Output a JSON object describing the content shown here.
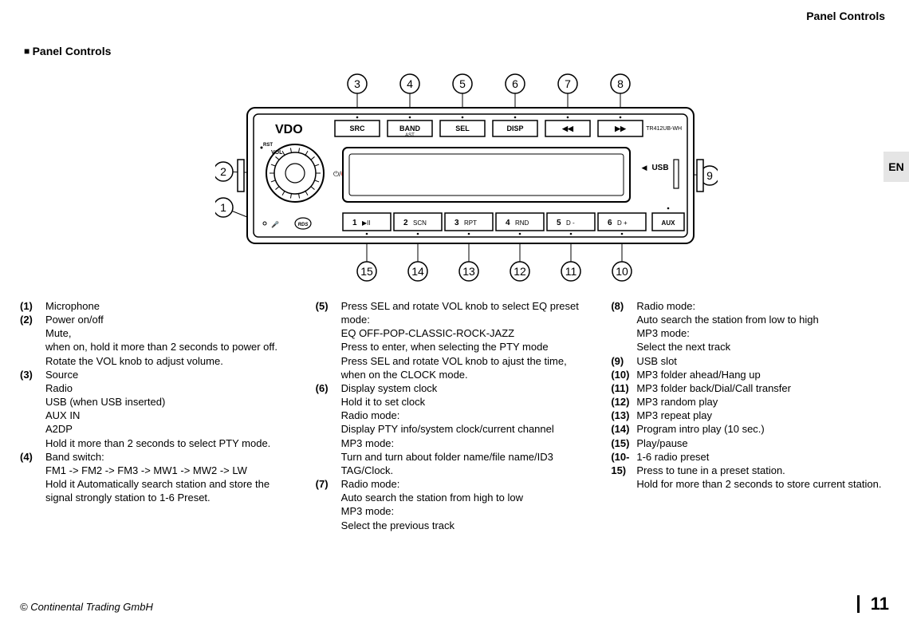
{
  "header": {
    "title": "Panel Controls"
  },
  "section_title": "Panel Controls",
  "lang_tab": "EN",
  "footer": {
    "copyright": "© Continental Trading GmbH",
    "page": "11"
  },
  "diagram": {
    "callouts_top": [
      "3",
      "4",
      "5",
      "6",
      "7",
      "8"
    ],
    "callouts_left": [
      "2",
      "1"
    ],
    "callouts_right": [
      "9"
    ],
    "callouts_bottom": [
      "15",
      "14",
      "13",
      "12",
      "11",
      "10"
    ],
    "brand": "VDO",
    "model": "TR412UB-WH",
    "top_buttons": [
      "SRC",
      "BAND",
      "SEL",
      "DISP",
      "◀◀",
      "▶▶"
    ],
    "band_sub": "AST",
    "usb_label": "USB",
    "usb_arrow": "◀",
    "rst": "RST",
    "vol": "VOL",
    "mic_icon": "mic",
    "rds_label": "RDS",
    "aux_label": "AUX",
    "bottom_buttons": [
      {
        "n": "1",
        "t": "▶II"
      },
      {
        "n": "2",
        "t": "SCN"
      },
      {
        "n": "3",
        "t": "RPT"
      },
      {
        "n": "4",
        "t": "RND"
      },
      {
        "n": "5",
        "t": "D -"
      },
      {
        "n": "6",
        "t": "D +"
      }
    ]
  },
  "columns": [
    [
      {
        "num": "(1)",
        "lines": [
          "Microphone"
        ]
      },
      {
        "num": "(2)",
        "lines": [
          "Power on/off",
          "Mute,",
          "when on, hold it more than 2 seconds to power off.",
          "Rotate the VOL knob to adjust volume."
        ]
      },
      {
        "num": "(3)",
        "lines": [
          "Source",
          "Radio",
          "USB (when USB inserted)",
          "AUX IN",
          "A2DP",
          "Hold it more than 2 seconds to select PTY mode."
        ]
      },
      {
        "num": "(4)",
        "lines": [
          "Band switch:",
          "FM1 -> FM2 -> FM3 -> MW1 -> MW2 -> LW",
          "Hold it Automatically search station and store the signal strongly station to 1-6 Preset."
        ]
      }
    ],
    [
      {
        "num": "(5)",
        "lines": [
          "Press SEL and rotate VOL knob to select EQ preset mode:",
          "EQ OFF-POP-CLASSIC-ROCK-JAZZ",
          "Press to enter, when selecting the PTY mode",
          "Press SEL and rotate VOL knob to ajust the time, when on the CLOCK mode."
        ]
      },
      {
        "num": "(6)",
        "lines": [
          "Display system clock",
          "Hold it to set clock",
          "Radio mode:",
          "Display PTY info/system clock/current channel",
          "MP3 mode:",
          "Turn and turn about folder name/file name/ID3 TAG/Clock."
        ]
      },
      {
        "num": "(7)",
        "lines": [
          "Radio mode:",
          "Auto search the station from high to low",
          "MP3 mode:",
          "Select the previous track"
        ]
      }
    ],
    [
      {
        "num": "(8)",
        "lines": [
          "Radio mode:",
          "Auto search the station from low to high",
          "MP3 mode:",
          "Select the next track"
        ]
      },
      {
        "num": "(9)",
        "lines": [
          "USB slot"
        ]
      },
      {
        "num": "(10)",
        "lines": [
          "MP3 folder ahead/Hang up"
        ]
      },
      {
        "num": "(11)",
        "lines": [
          "MP3 folder back/Dial/Call transfer"
        ]
      },
      {
        "num": "(12)",
        "lines": [
          "MP3 random play"
        ]
      },
      {
        "num": "(13)",
        "lines": [
          "MP3 repeat play"
        ]
      },
      {
        "num": "(14)",
        "lines": [
          "Program intro play (10 sec.)"
        ]
      },
      {
        "num": "(15)",
        "lines": [
          "Play/pause"
        ]
      },
      {
        "num": "(10-15)",
        "lines": [
          "1-6 radio preset",
          "Press to tune in a preset station.",
          "Hold for more than 2 seconds to store current station."
        ]
      }
    ]
  ]
}
